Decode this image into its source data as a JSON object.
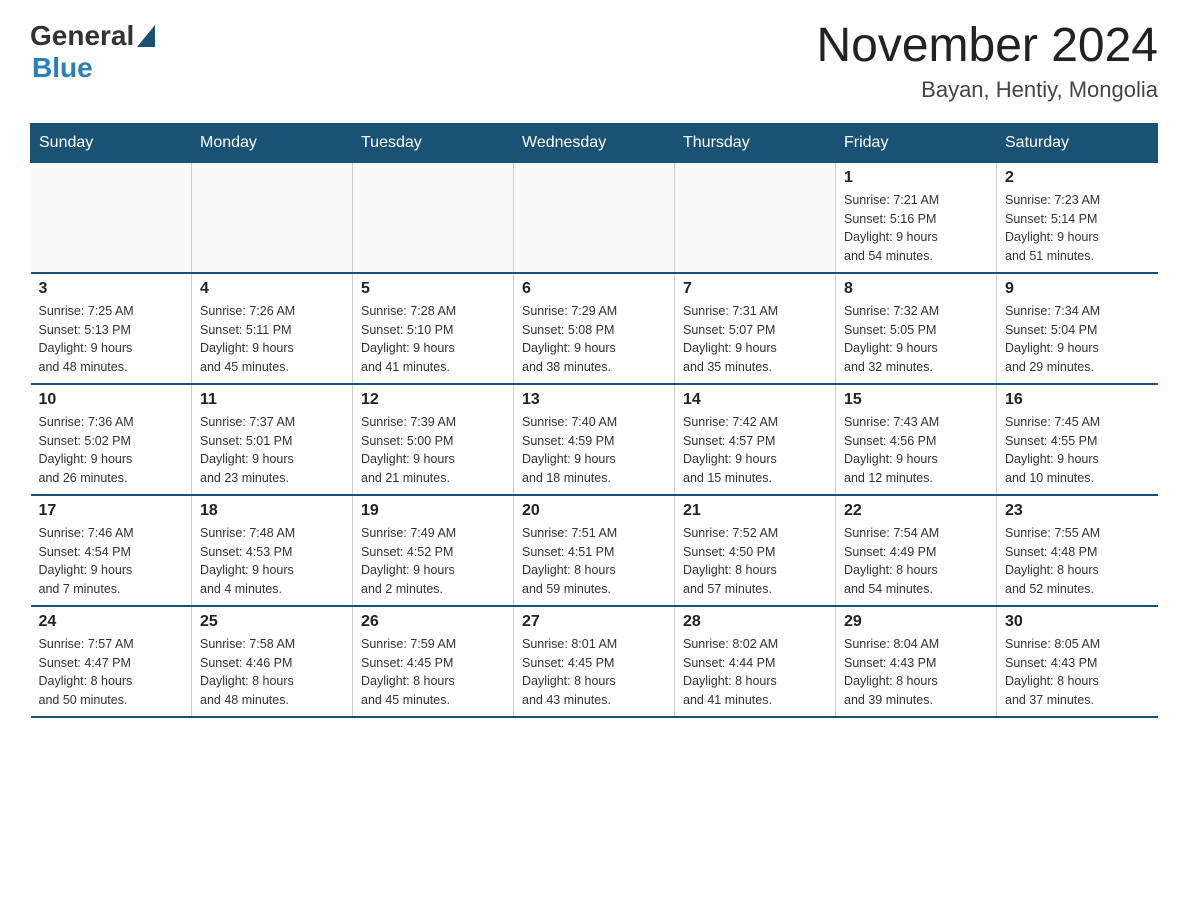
{
  "header": {
    "logo_general": "General",
    "logo_blue": "Blue",
    "month_year": "November 2024",
    "location": "Bayan, Hentiy, Mongolia"
  },
  "weekdays": [
    "Sunday",
    "Monday",
    "Tuesday",
    "Wednesday",
    "Thursday",
    "Friday",
    "Saturday"
  ],
  "weeks": [
    [
      {
        "day": "",
        "info": ""
      },
      {
        "day": "",
        "info": ""
      },
      {
        "day": "",
        "info": ""
      },
      {
        "day": "",
        "info": ""
      },
      {
        "day": "",
        "info": ""
      },
      {
        "day": "1",
        "info": "Sunrise: 7:21 AM\nSunset: 5:16 PM\nDaylight: 9 hours\nand 54 minutes."
      },
      {
        "day": "2",
        "info": "Sunrise: 7:23 AM\nSunset: 5:14 PM\nDaylight: 9 hours\nand 51 minutes."
      }
    ],
    [
      {
        "day": "3",
        "info": "Sunrise: 7:25 AM\nSunset: 5:13 PM\nDaylight: 9 hours\nand 48 minutes."
      },
      {
        "day": "4",
        "info": "Sunrise: 7:26 AM\nSunset: 5:11 PM\nDaylight: 9 hours\nand 45 minutes."
      },
      {
        "day": "5",
        "info": "Sunrise: 7:28 AM\nSunset: 5:10 PM\nDaylight: 9 hours\nand 41 minutes."
      },
      {
        "day": "6",
        "info": "Sunrise: 7:29 AM\nSunset: 5:08 PM\nDaylight: 9 hours\nand 38 minutes."
      },
      {
        "day": "7",
        "info": "Sunrise: 7:31 AM\nSunset: 5:07 PM\nDaylight: 9 hours\nand 35 minutes."
      },
      {
        "day": "8",
        "info": "Sunrise: 7:32 AM\nSunset: 5:05 PM\nDaylight: 9 hours\nand 32 minutes."
      },
      {
        "day": "9",
        "info": "Sunrise: 7:34 AM\nSunset: 5:04 PM\nDaylight: 9 hours\nand 29 minutes."
      }
    ],
    [
      {
        "day": "10",
        "info": "Sunrise: 7:36 AM\nSunset: 5:02 PM\nDaylight: 9 hours\nand 26 minutes."
      },
      {
        "day": "11",
        "info": "Sunrise: 7:37 AM\nSunset: 5:01 PM\nDaylight: 9 hours\nand 23 minutes."
      },
      {
        "day": "12",
        "info": "Sunrise: 7:39 AM\nSunset: 5:00 PM\nDaylight: 9 hours\nand 21 minutes."
      },
      {
        "day": "13",
        "info": "Sunrise: 7:40 AM\nSunset: 4:59 PM\nDaylight: 9 hours\nand 18 minutes."
      },
      {
        "day": "14",
        "info": "Sunrise: 7:42 AM\nSunset: 4:57 PM\nDaylight: 9 hours\nand 15 minutes."
      },
      {
        "day": "15",
        "info": "Sunrise: 7:43 AM\nSunset: 4:56 PM\nDaylight: 9 hours\nand 12 minutes."
      },
      {
        "day": "16",
        "info": "Sunrise: 7:45 AM\nSunset: 4:55 PM\nDaylight: 9 hours\nand 10 minutes."
      }
    ],
    [
      {
        "day": "17",
        "info": "Sunrise: 7:46 AM\nSunset: 4:54 PM\nDaylight: 9 hours\nand 7 minutes."
      },
      {
        "day": "18",
        "info": "Sunrise: 7:48 AM\nSunset: 4:53 PM\nDaylight: 9 hours\nand 4 minutes."
      },
      {
        "day": "19",
        "info": "Sunrise: 7:49 AM\nSunset: 4:52 PM\nDaylight: 9 hours\nand 2 minutes."
      },
      {
        "day": "20",
        "info": "Sunrise: 7:51 AM\nSunset: 4:51 PM\nDaylight: 8 hours\nand 59 minutes."
      },
      {
        "day": "21",
        "info": "Sunrise: 7:52 AM\nSunset: 4:50 PM\nDaylight: 8 hours\nand 57 minutes."
      },
      {
        "day": "22",
        "info": "Sunrise: 7:54 AM\nSunset: 4:49 PM\nDaylight: 8 hours\nand 54 minutes."
      },
      {
        "day": "23",
        "info": "Sunrise: 7:55 AM\nSunset: 4:48 PM\nDaylight: 8 hours\nand 52 minutes."
      }
    ],
    [
      {
        "day": "24",
        "info": "Sunrise: 7:57 AM\nSunset: 4:47 PM\nDaylight: 8 hours\nand 50 minutes."
      },
      {
        "day": "25",
        "info": "Sunrise: 7:58 AM\nSunset: 4:46 PM\nDaylight: 8 hours\nand 48 minutes."
      },
      {
        "day": "26",
        "info": "Sunrise: 7:59 AM\nSunset: 4:45 PM\nDaylight: 8 hours\nand 45 minutes."
      },
      {
        "day": "27",
        "info": "Sunrise: 8:01 AM\nSunset: 4:45 PM\nDaylight: 8 hours\nand 43 minutes."
      },
      {
        "day": "28",
        "info": "Sunrise: 8:02 AM\nSunset: 4:44 PM\nDaylight: 8 hours\nand 41 minutes."
      },
      {
        "day": "29",
        "info": "Sunrise: 8:04 AM\nSunset: 4:43 PM\nDaylight: 8 hours\nand 39 minutes."
      },
      {
        "day": "30",
        "info": "Sunrise: 8:05 AM\nSunset: 4:43 PM\nDaylight: 8 hours\nand 37 minutes."
      }
    ]
  ]
}
